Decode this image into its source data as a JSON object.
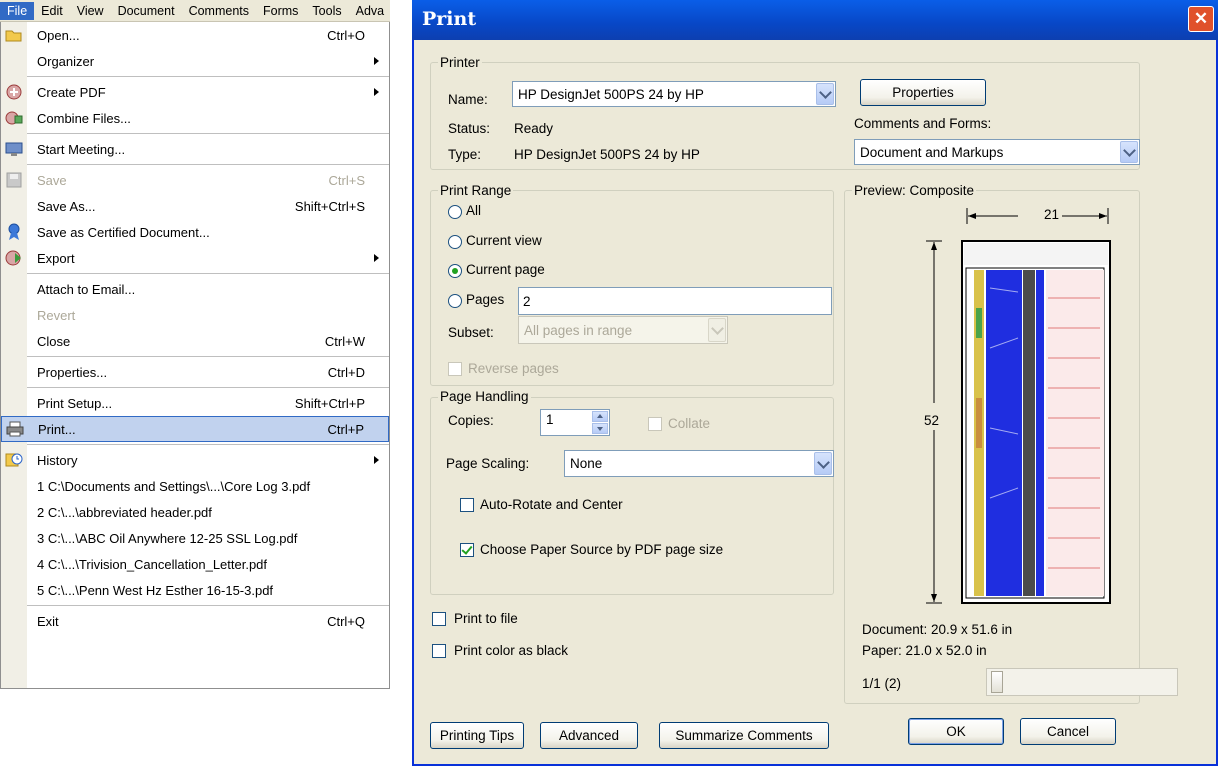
{
  "menubar": {
    "items": [
      "File",
      "Edit",
      "View",
      "Document",
      "Comments",
      "Forms",
      "Tools",
      "Adva"
    ],
    "active": "File"
  },
  "file_menu": [
    {
      "icon": "folder-open-icon",
      "label": "Open...",
      "shortcut": "Ctrl+O"
    },
    {
      "label": "Organizer",
      "submenu": true
    },
    {
      "sep": true
    },
    {
      "icon": "create-pdf-icon",
      "label": "Create PDF",
      "submenu": true
    },
    {
      "icon": "combine-files-icon",
      "label": "Combine Files..."
    },
    {
      "sep": true
    },
    {
      "icon": "meeting-icon",
      "label": "Start Meeting..."
    },
    {
      "sep": true
    },
    {
      "icon": "save-icon",
      "label": "Save",
      "shortcut": "Ctrl+S",
      "disabled": true
    },
    {
      "label": "Save As...",
      "shortcut": "Shift+Ctrl+S"
    },
    {
      "icon": "certified-ribbon-icon",
      "label": "Save as Certified Document..."
    },
    {
      "icon": "export-icon",
      "label": "Export",
      "submenu": true
    },
    {
      "sep": true
    },
    {
      "label": "Attach to Email..."
    },
    {
      "label": "Revert",
      "disabled": true
    },
    {
      "label": "Close",
      "shortcut": "Ctrl+W"
    },
    {
      "sep": true
    },
    {
      "label": "Properties...",
      "shortcut": "Ctrl+D"
    },
    {
      "sep": true
    },
    {
      "label": "Print Setup...",
      "shortcut": "Shift+Ctrl+P"
    },
    {
      "icon": "printer-icon",
      "label": "Print...",
      "shortcut": "Ctrl+P",
      "highlighted": true
    },
    {
      "sep": true
    },
    {
      "icon": "history-icon",
      "label": "History",
      "submenu": true
    },
    {
      "label": "1 C:\\Documents and Settings\\...\\Core Log 3.pdf"
    },
    {
      "label": "2 C:\\...\\abbreviated header.pdf"
    },
    {
      "label": "3 C:\\...\\ABC Oil Anywhere 12-25 SSL Log.pdf"
    },
    {
      "label": "4 C:\\...\\Trivision_Cancellation_Letter.pdf"
    },
    {
      "label": "5 C:\\...\\Penn West Hz Esther 16-15-3.pdf"
    },
    {
      "sep": true
    },
    {
      "label": "Exit",
      "shortcut": "Ctrl+Q"
    }
  ],
  "dialog": {
    "title": "Print",
    "printer": {
      "group_label": "Printer",
      "name_label": "Name:",
      "name_value": "HP DesignJet 500PS 24 by HP",
      "status_label": "Status:",
      "status_value": "Ready",
      "type_label": "Type:",
      "type_value": "HP DesignJet 500PS 24 by HP",
      "properties_button": "Properties",
      "comments_forms_label": "Comments and Forms:",
      "comments_forms_value": "Document and Markups"
    },
    "print_range": {
      "group_label": "Print Range",
      "all": "All",
      "current_view": "Current view",
      "current_page": "Current page",
      "pages": "Pages",
      "pages_value": "2",
      "selected": "current_page",
      "subset_label": "Subset:",
      "subset_value": "All pages in range",
      "reverse_pages": "Reverse pages"
    },
    "page_handling": {
      "group_label": "Page Handling",
      "copies_label": "Copies:",
      "copies_value": "1",
      "collate": "Collate",
      "scaling_label": "Page Scaling:",
      "scaling_value": "None",
      "auto_rotate": "Auto-Rotate and Center",
      "auto_rotate_checked": false,
      "choose_paper": "Choose Paper Source by PDF page size",
      "choose_paper_checked": true
    },
    "print_to_file": "Print to file",
    "print_color_black": "Print color as black",
    "preview": {
      "group_label": "Preview: Composite",
      "width_dim": "21",
      "height_dim": "52",
      "document_size": "Document: 20.9 x 51.6 in",
      "paper_size": "Paper: 21.0 x 52.0 in",
      "page_counter": "1/1 (2)",
      "page_slider_fraction": 0
    },
    "buttons": {
      "printing_tips": "Printing Tips",
      "advanced": "Advanced",
      "summarize": "Summarize Comments",
      "ok": "OK",
      "cancel": "Cancel"
    },
    "colors": {
      "title_bar": "#0a5ee8",
      "dialog_bg": "#ece9d8",
      "close_button": "#e0512b",
      "menu_highlight": "#c1d2ee",
      "preview_blue": "#1f2ee0"
    }
  }
}
